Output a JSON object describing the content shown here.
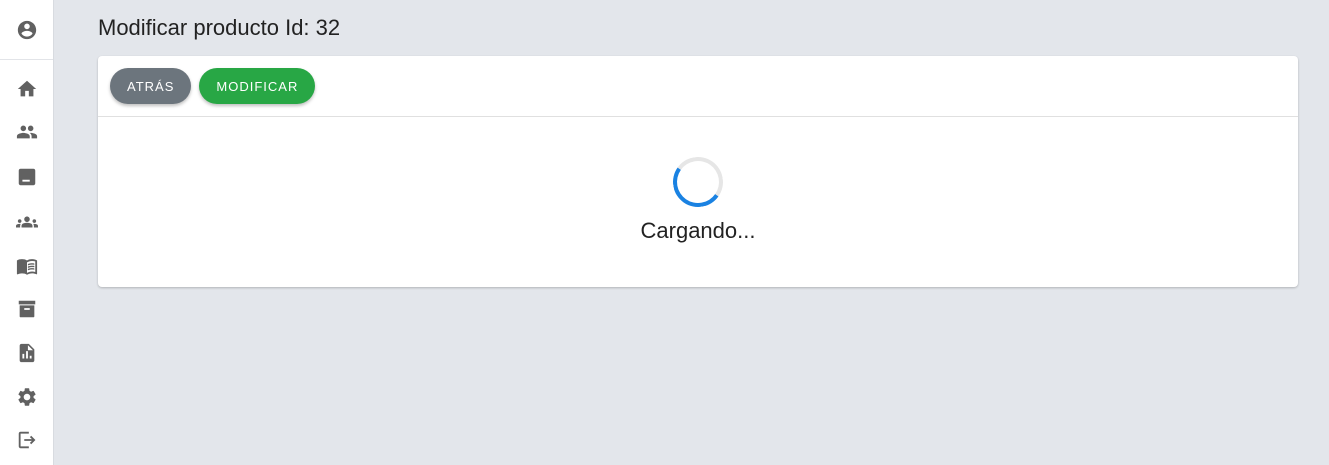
{
  "sidebar": {
    "avatar_icon": "account-circle-icon",
    "items": [
      {
        "icon": "home-icon"
      },
      {
        "icon": "people-icon"
      },
      {
        "icon": "store-icon"
      },
      {
        "icon": "groups-icon"
      },
      {
        "icon": "menu-book-icon"
      },
      {
        "icon": "archive-icon"
      },
      {
        "icon": "report-icon"
      },
      {
        "icon": "settings-icon"
      },
      {
        "icon": "logout-icon"
      }
    ]
  },
  "page": {
    "title": "Modificar producto Id: 32"
  },
  "toolbar": {
    "back_label": "ATRÁS",
    "modify_label": "MODIFICAR"
  },
  "loading": {
    "text": "Cargando..."
  },
  "colors": {
    "background": "#e3e6eb",
    "back_button": "#6c757d",
    "modify_button": "#28a745",
    "spinner": "#1a82e2"
  }
}
